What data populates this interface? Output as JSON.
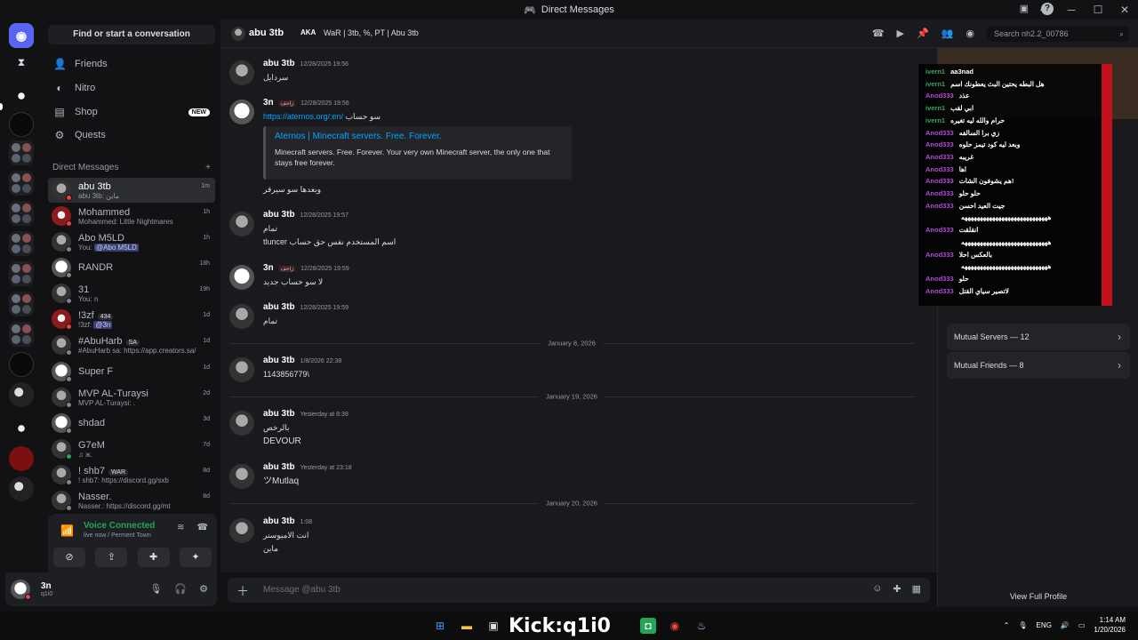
{
  "window": {
    "title": "Direct Messages"
  },
  "sidebar": {
    "search_label": "Find or start a conversation",
    "nav": [
      {
        "label": "Friends",
        "icon": "friends-icon"
      },
      {
        "label": "Nitro",
        "icon": "nitro-icon"
      },
      {
        "label": "Shop",
        "icon": "shop-icon",
        "badge": "NEW"
      },
      {
        "label": "Quests",
        "icon": "quests-icon"
      }
    ],
    "dm_header": "Direct Messages",
    "dm_add": "+",
    "dms": [
      {
        "name": "abu 3tb",
        "sub": "abu 3tb: ماين",
        "time": "1m"
      },
      {
        "name": "Mohammed",
        "sub": "Mohammed: Little Nightmares",
        "time": "1h"
      },
      {
        "name": "Abo M5LD",
        "sub_prefix": "You: ",
        "sub_mention": "@Abo M5LD",
        "time": "1h"
      },
      {
        "name": "RANDR",
        "sub": "",
        "time": "18h"
      },
      {
        "name": "31",
        "sub": "You: n",
        "time": "19h"
      },
      {
        "name": "!3zf",
        "tag": "434",
        "sub_prefix": "!3zf: ",
        "sub_mention": "@3n",
        "time": "1d"
      },
      {
        "name": "#AbuHarb",
        "tag": "SA",
        "sub": "#AbuHarb sa: https://app.creators.sa/",
        "time": "1d"
      },
      {
        "name": "Super F",
        "sub": "",
        "time": "1d"
      },
      {
        "name": "MVP AL-Turaysi",
        "sub": "MVP AL-Turaysi: .",
        "time": "2d"
      },
      {
        "name": "shdad",
        "sub": "",
        "time": "3d"
      },
      {
        "name": "G7eM",
        "sub": "♫ ж.",
        "time": "7d"
      },
      {
        "name": "! shb7",
        "tag": "WAR",
        "sub": "! shb7: https://discord.gg/sxb",
        "time": "8d"
      },
      {
        "name": "Nasser.",
        "sub": "Nasser.: https://discord.gg/mt",
        "time": "8d"
      }
    ]
  },
  "voice": {
    "title": "Voice Connected",
    "sub": "live now / Perment Town"
  },
  "user": {
    "name": "3n",
    "tag": "q1i0"
  },
  "header": {
    "name": "abu 3tb",
    "aka": "AKA",
    "tag": "WaR | 3tb, %, PT | Abu 3tb",
    "search_placeholder": "Search nh2.2_00786"
  },
  "messages": [
    {
      "author": "abu 3tb",
      "time": "12/28/2025 19:56",
      "lines": [
        "سردايل"
      ]
    },
    {
      "author": "3n",
      "role": "زاحف",
      "time": "12/28/2025 19:56",
      "link": "https://aternos.org/:en/",
      "link_suffix": " سو حساب",
      "embed": {
        "title": "Aternos | Minecraft servers. Free. Forever.",
        "desc": "Minecraft servers. Free. Forever. Your very own Minecraft server, the only one that stays free forever."
      },
      "after": "وبعدها سو سيرفر"
    },
    {
      "author": "abu 3tb",
      "time": "12/28/2025 19:57",
      "lines": [
        "تمام",
        "tluncer اسم المستخدم نفس حق حساب"
      ]
    },
    {
      "author": "3n",
      "role": "زاحف",
      "time": "12/28/2025 19:59",
      "lines": [
        "لا سو حساب جديد"
      ]
    },
    {
      "author": "abu 3tb",
      "time": "12/28/2025 19:59",
      "lines": [
        "تمام"
      ]
    },
    {
      "author": "abu 3tb",
      "time": "1/8/2026 22:38",
      "lines": [
        "1143856779\\"
      ]
    },
    {
      "author": "abu 3tb",
      "time": "Yesterday at 8:39",
      "lines": [
        "بالرخص",
        "DEVOUR"
      ]
    },
    {
      "author": "abu 3tb",
      "time": "Yesterday at 23:18",
      "lines": [
        "ツMutlaq"
      ]
    },
    {
      "author": "abu 3tb",
      "time": "1:08",
      "lines": [
        "انت الاميوسنر",
        "ماين"
      ]
    }
  ],
  "dividers": [
    "January 8, 2026",
    "January 19, 2026",
    "January 20, 2026"
  ],
  "composer": {
    "placeholder": "Message @abu 3tb"
  },
  "profile": {
    "mutual_servers": "Mutual Servers — 12",
    "mutual_friends": "Mutual Friends — 8",
    "view_full": "View Full Profile"
  },
  "overlay_chat": [
    {
      "user": "ivern1",
      "text": "aa3nad",
      "color": "#3ba55d"
    },
    {
      "user": "ivern1",
      "text": "هل البطه يحتين البث يعطونك اسم",
      "color": "#3ba55d"
    },
    {
      "user": "Anod333",
      "text": "عذد",
      "color": "#b44ad6"
    },
    {
      "user": "ivern1",
      "text": "ابي لقب",
      "color": "#3ba55d"
    },
    {
      "user": "ivern1",
      "text": "حرام والله ليه تغيره",
      "color": "#3ba55d"
    },
    {
      "user": "Anod333",
      "text": "زي برا السالفه",
      "color": "#b44ad6"
    },
    {
      "user": "Anod333",
      "text": "وبعد ليه كود تيمز حلوه",
      "color": "#b44ad6"
    },
    {
      "user": "Anod333",
      "text": "غريبه",
      "color": "#b44ad6"
    },
    {
      "user": "Anod333",
      "text": "اها",
      "color": "#b44ad6"
    },
    {
      "user": "Anod333",
      "text": "هم يشوفون الشات!",
      "color": "#b44ad6"
    },
    {
      "user": "Anod333",
      "text": "حلو حلو",
      "color": "#b44ad6"
    },
    {
      "user": "Anod333",
      "text": "جيت العيد احسن",
      "color": "#b44ad6"
    },
    {
      "user": "",
      "text": "ههههههههههههههههههههههههههههه",
      "color": "#ffffff"
    },
    {
      "user": "Anod333",
      "text": "انقلقت",
      "color": "#b44ad6"
    },
    {
      "user": "",
      "text": "ههههههههههههههههههههههههههههه",
      "color": "#ffffff"
    },
    {
      "user": "Anod333",
      "text": "بالعكس احلا",
      "color": "#b44ad6"
    },
    {
      "user": "",
      "text": "ههههههههههههههههههههههههههههه",
      "color": "#ffffff"
    },
    {
      "user": "Anod333",
      "text": "حلو",
      "color": "#b44ad6"
    },
    {
      "user": "Anod333",
      "text": "لاتصير سياي القتل",
      "color": "#b44ad6"
    }
  ],
  "taskbar": {
    "stream_overlay": "Kick:q1i0",
    "lang": "ENG",
    "time": "1:14 AM",
    "date": "1/20/2026"
  }
}
